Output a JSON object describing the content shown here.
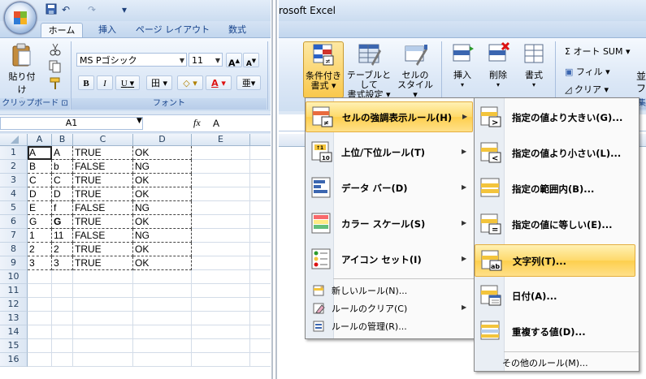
{
  "left_window": {
    "quick_access": {
      "undo": "↶",
      "redo": "↷",
      "customize": "▾"
    },
    "tabs": [
      "ホーム",
      "挿入",
      "ページ レイアウト",
      "数式"
    ],
    "clipboard": {
      "paste_label": "貼り付け",
      "group_label": "クリップボード"
    },
    "font": {
      "font_name": "MS Pゴシック",
      "font_size": "11",
      "grow": "A",
      "shrink": "A",
      "bold": "B",
      "italic": "I",
      "underline": "U",
      "border": "田",
      "fill": "◇",
      "color": "A",
      "phonetic": "亜",
      "group_label": "フォント"
    },
    "name_box": "A1",
    "fx": "fx",
    "formula": "A",
    "columns": [
      "A",
      "B",
      "C",
      "D",
      "E"
    ],
    "rows": [
      {
        "num": "1",
        "cells": [
          "A",
          "A",
          "TRUE",
          "OK"
        ]
      },
      {
        "num": "2",
        "cells": [
          "B",
          "b",
          "FALSE",
          "NG"
        ]
      },
      {
        "num": "3",
        "cells": [
          "C",
          "C",
          "TRUE",
          "OK"
        ]
      },
      {
        "num": "4",
        "cells": [
          "D",
          "D",
          "TRUE",
          "OK"
        ]
      },
      {
        "num": "5",
        "cells": [
          "E",
          "f",
          "FALSE",
          "NG"
        ]
      },
      {
        "num": "6",
        "cells": [
          "G",
          "G",
          "TRUE",
          "OK"
        ]
      },
      {
        "num": "7",
        "cells": [
          "1",
          "11",
          "FALSE",
          "NG"
        ]
      },
      {
        "num": "8",
        "cells": [
          "2",
          "2",
          "TRUE",
          "OK"
        ]
      },
      {
        "num": "9",
        "cells": [
          "3",
          "3",
          "TRUE",
          "OK"
        ]
      },
      {
        "num": "10",
        "cells": [
          "",
          "",
          "",
          ""
        ]
      },
      {
        "num": "11",
        "cells": [
          "",
          "",
          "",
          ""
        ]
      },
      {
        "num": "12",
        "cells": [
          "",
          "",
          "",
          ""
        ]
      },
      {
        "num": "13",
        "cells": [
          "",
          "",
          "",
          ""
        ]
      },
      {
        "num": "14",
        "cells": [
          "",
          "",
          "",
          ""
        ]
      },
      {
        "num": "15",
        "cells": [
          "",
          "",
          "",
          ""
        ]
      },
      {
        "num": "16",
        "cells": [
          "",
          "",
          "",
          ""
        ]
      }
    ]
  },
  "right_window": {
    "title": "rosoft Excel",
    "ribbon": {
      "conditional_format": [
        "条件付き",
        "書式"
      ],
      "table_format": [
        "テーブルとして",
        "書式設定"
      ],
      "cell_style": [
        "セルの",
        "スタイル"
      ],
      "insert": "挿入",
      "delete": "削除",
      "format": "書式",
      "autosum": "Σ オート SUM",
      "fill": "フィル",
      "clear": "クリア",
      "sort": "並",
      "sort2": "フ",
      "edit_label": "集"
    },
    "cf_menu": {
      "items": [
        {
          "label": "セルの強調表示ルール(H)",
          "hot": "H"
        },
        {
          "label": "上位/下位ルール(T)",
          "hot": "T"
        },
        {
          "label": "データ バー(D)",
          "hot": "D"
        },
        {
          "label": "カラー スケール(S)",
          "hot": "S"
        },
        {
          "label": "アイコン セット(I)",
          "hot": "I"
        }
      ],
      "small_items": [
        {
          "label": "新しいルール(N)..."
        },
        {
          "label": "ルールのクリア(C)"
        },
        {
          "label": "ルールの管理(R)..."
        }
      ]
    },
    "highlight_menu": {
      "items": [
        {
          "label": "指定の値より大きい(G)..."
        },
        {
          "label": "指定の値より小さい(L)..."
        },
        {
          "label": "指定の範囲内(B)..."
        },
        {
          "label": "指定の値に等しい(E)..."
        },
        {
          "label": "文字列(T)..."
        },
        {
          "label": "日付(A)..."
        },
        {
          "label": "重複する値(D)..."
        }
      ],
      "more": "その他のルール(M)..."
    }
  },
  "colors": {
    "ribbon_blue": "#dde8f5",
    "highlight": "#fdcf4d",
    "label_blue": "#15428b"
  }
}
